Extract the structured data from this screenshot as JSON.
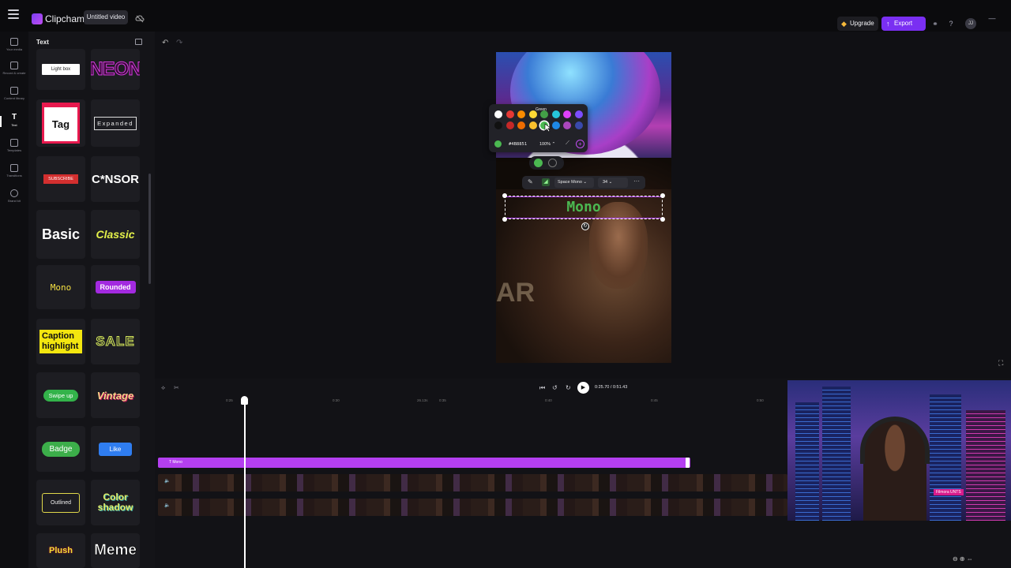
{
  "app": {
    "brand": "Clipchamp",
    "project_title": "Untitled video",
    "upgrade_label": "Upgrade",
    "export_label": "Export",
    "avatar_initials": "JJ"
  },
  "rail": {
    "items": [
      {
        "label": "Your media"
      },
      {
        "label": "Record & create"
      },
      {
        "label": "Content library"
      },
      {
        "label": "Text"
      },
      {
        "label": "Templates"
      },
      {
        "label": "Transitions"
      },
      {
        "label": "Brand kit"
      }
    ]
  },
  "panel": {
    "title": "Text",
    "tiles": [
      {
        "label": "Light box"
      },
      {
        "label": "NEON"
      },
      {
        "label": "Tag"
      },
      {
        "label": "Expanded"
      },
      {
        "label": "SUBSCRIBE"
      },
      {
        "label": "C*NSOR"
      },
      {
        "label": "Basic"
      },
      {
        "label": "Classic"
      },
      {
        "label": "Mono"
      },
      {
        "label": "Rounded"
      },
      {
        "label": "Caption highlight"
      },
      {
        "label": "SALE"
      },
      {
        "label": "Swipe up"
      },
      {
        "label": "Vintage"
      },
      {
        "label": "Badge"
      },
      {
        "label": "Like"
      },
      {
        "label": "Outlined"
      },
      {
        "label": "Color shadow"
      },
      {
        "label": "Plush"
      },
      {
        "label": "Meme"
      }
    ]
  },
  "canvas": {
    "overlay_text": "Mono",
    "overlay_color": "#4bb851",
    "toolbar": {
      "font": "Space Mono",
      "size": "34"
    },
    "color_picker": {
      "tooltip": "Green",
      "hex": "#4B8851",
      "opacity": "100%",
      "palette_row1": [
        "#ffffff",
        "#e53935",
        "#fb8c00",
        "#fdd835",
        "#43a047",
        "#26c6da",
        "#e040fb",
        "#7c4dff"
      ],
      "palette_row2": [
        "#111111",
        "#c62828",
        "#ef6c00",
        "#fbc02d",
        "#4bb851",
        "#1e88e5",
        "#ab47bc",
        "#3949ab"
      ]
    },
    "background_text": "AR"
  },
  "timeline": {
    "time_current": "0:25.70",
    "time_total": "0:51.43",
    "ruler_ticks": [
      "0:25",
      "0:30",
      "26.13s",
      "0:35",
      "0:40",
      "0:45",
      "0:50"
    ],
    "text_clip_label": "Mono"
  },
  "webcam": {
    "sign": "Filmora UNTS"
  },
  "colors": {
    "accent": "#7a2ff2",
    "text_clip": "#b43ff0",
    "overlay_green": "#4bb851"
  }
}
